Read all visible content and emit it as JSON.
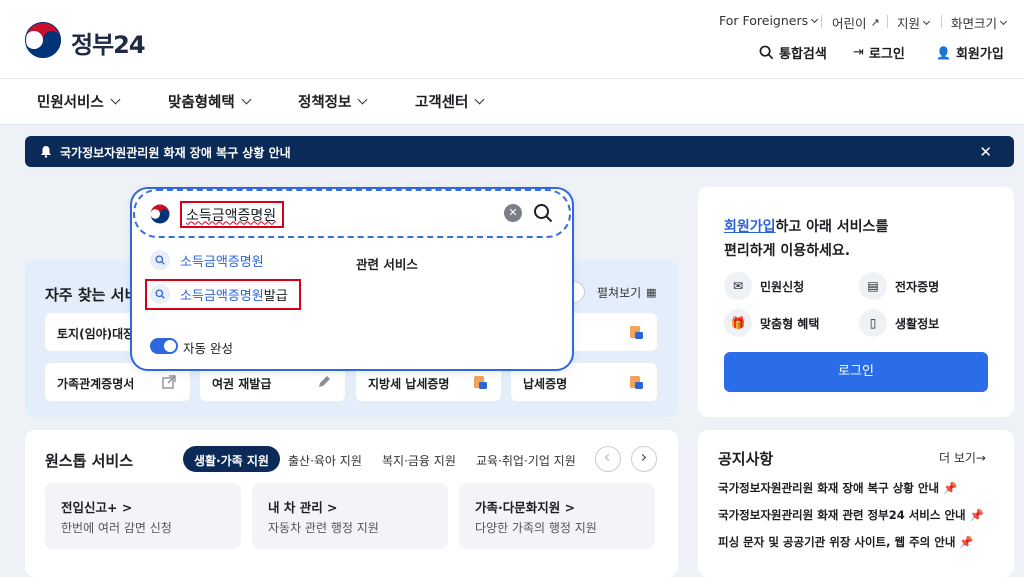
{
  "header": {
    "logo_text": "정부24",
    "util_links": [
      "For Foreigners",
      "어린이",
      "지원",
      "화면크기"
    ],
    "actions": {
      "search": "통합검색",
      "login": "로그인",
      "signup": "회원가입"
    }
  },
  "gnb": [
    "민원서비스",
    "맞춤형혜택",
    "정책정보",
    "고객센터"
  ],
  "banner": {
    "text": "국가정보자원관리원 화재 장애 복구 상황 안내"
  },
  "search": {
    "value": "소득금액증명원",
    "suggestions": [
      {
        "match": "소득금액증명원",
        "rest": ""
      },
      {
        "match": "소득금액증명원",
        "rest": "발급"
      }
    ],
    "related_label": "관련 서비스",
    "autocomplete_label": "자동 완성"
  },
  "frequent": {
    "title": "자주 찾는 서비",
    "expand_label": "펼쳐보기",
    "tiles": [
      "토지(임야)대장",
      "가족관계증명서",
      "여권 재발급",
      "지방세 납세증명",
      "납세증명"
    ]
  },
  "onestop": {
    "title": "원스톱 서비스",
    "chips": [
      "생활·가족 지원",
      "출산·육아 지원",
      "복지·금융 지원",
      "교육·취업·기업 지원"
    ],
    "boxes": [
      {
        "title": "전입신고+ >",
        "desc": "한번에 여러 감면 신청"
      },
      {
        "title": "내 차 관리 >",
        "desc": "자동차 관련 행정 지원"
      },
      {
        "title": "가족·다문화지원 >",
        "desc": "다양한 가족의 행정 지원"
      }
    ]
  },
  "login_card": {
    "link": "회원가입",
    "line1_rest": "하고 아래 서비스를",
    "line2": "편리하게 이용하세요.",
    "services": [
      "민원신청",
      "전자증명",
      "맞춤형 혜택",
      "생활정보"
    ],
    "button": "로그인"
  },
  "notices": {
    "title": "공지사항",
    "more": "더 보기→",
    "items": [
      "국가정보자원관리원 화재 장애 복구 상황 안내",
      "국가정보자원관리원 화재 관련 정부24 서비스 안내",
      "피싱 문자 및 공공기관 위장 사이트, 웹 주의 안내"
    ]
  },
  "colors": {
    "brand_navy": "#0b2a57",
    "accent_blue": "#2b6de8",
    "highlight_red": "#d9001b"
  }
}
